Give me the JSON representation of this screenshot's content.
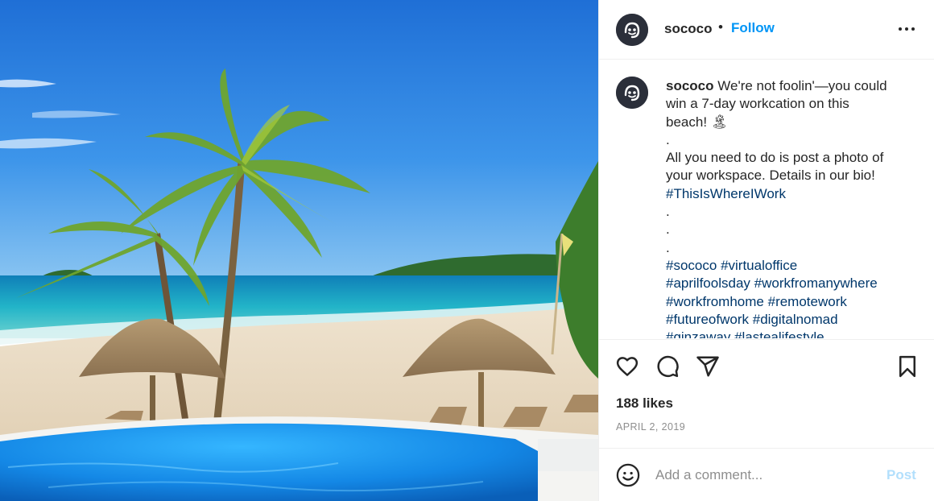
{
  "post": {
    "username": "sococo",
    "separator": "•",
    "follow_label": "Follow",
    "more_icon": "more-options-icon",
    "caption_lines": [
      "We're not foolin'—you could",
      "win a 7-day workcation on this",
      "beach! 🏝",
      ".",
      "All you need to do is post a photo of",
      "your workspace. Details in our bio!"
    ],
    "hashtag_lines": [
      [
        "#ThisIsWhereIWork"
      ],
      [
        "."
      ],
      [
        "."
      ],
      [
        "."
      ],
      [
        "#sococo",
        "#virtualoffice"
      ],
      [
        "#aprilfoolsday",
        "#workfromanywhere"
      ],
      [
        "#workfromhome",
        "#remotework"
      ],
      [
        "#futureofwork",
        "#digitalnomad"
      ],
      [
        "#ginzaway",
        "#lastealifestyle"
      ]
    ],
    "likes": "188 likes",
    "date": "APRIL 2, 2019",
    "comment_placeholder": "Add a comment...",
    "post_label": "Post",
    "icons": [
      "heart-icon",
      "comment-icon",
      "share-icon",
      "bookmark-icon",
      "emoji-icon"
    ],
    "colors": {
      "link_blue": "#0095f6",
      "hashtag": "#00376b",
      "muted": "#8e8e8e",
      "post_disabled": "#b2dffc",
      "avatar_bg": "#2b2f3a"
    }
  }
}
